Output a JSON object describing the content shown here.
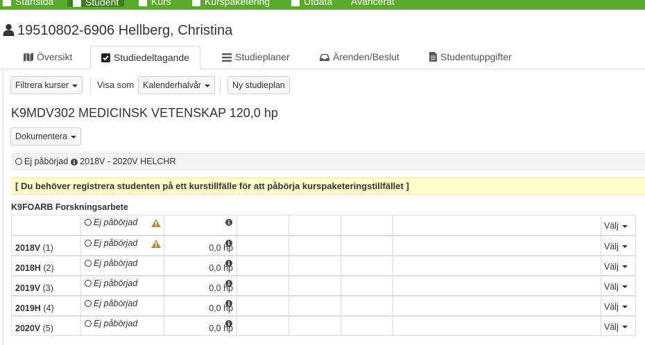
{
  "topnav": {
    "items": [
      {
        "label": "Startsida"
      },
      {
        "label": "Student"
      },
      {
        "label": "Kurs"
      },
      {
        "label": "Kurspaketering"
      },
      {
        "label": "Utdata"
      },
      {
        "label": "Avancerat"
      }
    ],
    "active_color": "#3d7f1b",
    "bar_color": "#5aaa2c"
  },
  "student": {
    "title": "19510802-6906 Hellberg, Christina",
    "icon": "user-icon"
  },
  "tabs": [
    {
      "label": "Översikt",
      "icon": "map-icon"
    },
    {
      "label": "Studiedeltagande",
      "icon": "check-square-icon"
    },
    {
      "label": "Studieplaner",
      "icon": "list-icon"
    },
    {
      "label": "Ärenden/Beslut",
      "icon": "inbox-icon"
    },
    {
      "label": "Studentuppgifter",
      "icon": "file-icon"
    }
  ],
  "toolbar": {
    "filter_label": "Filtrera kurser",
    "show_as_label": "Visa som",
    "show_as_value": "Kalenderhalvår",
    "new_plan_label": "Ny studieplan"
  },
  "program": {
    "title": "K9MDV302 MEDICINSK VETENSKAP 120,0 hp",
    "document_label": "Dokumentera",
    "status": "Ej påbörjad",
    "period": "2018V - 2020V HELCHR"
  },
  "alert": {
    "text": "[ Du behöver registrera studenten på ett kurstillfälle för att påbörja kurspaketeringstillfället ]"
  },
  "course": {
    "heading": "K9FOARB Forskningsarbete",
    "header_row": {
      "status": "Ej påbörjad",
      "action": "Välj"
    },
    "rows": [
      {
        "semester": "2018V",
        "index": "(1)",
        "status": "Ej påbörjad",
        "hp": "0,0 hp",
        "action": "Välj"
      },
      {
        "semester": "2018H",
        "index": "(2)",
        "status": "Ej påbörjad",
        "hp": "0,0 hp",
        "action": "Välj"
      },
      {
        "semester": "2019V",
        "index": "(3)",
        "status": "Ej påbörjad",
        "hp": "0,0 hp",
        "action": "Välj"
      },
      {
        "semester": "2019H",
        "index": "(4)",
        "status": "Ej påbörjad",
        "hp": "0,0 hp",
        "action": "Välj"
      },
      {
        "semester": "2020V",
        "index": "(5)",
        "status": "Ej påbörjad",
        "hp": "0,0 hp",
        "action": "Välj"
      }
    ]
  }
}
